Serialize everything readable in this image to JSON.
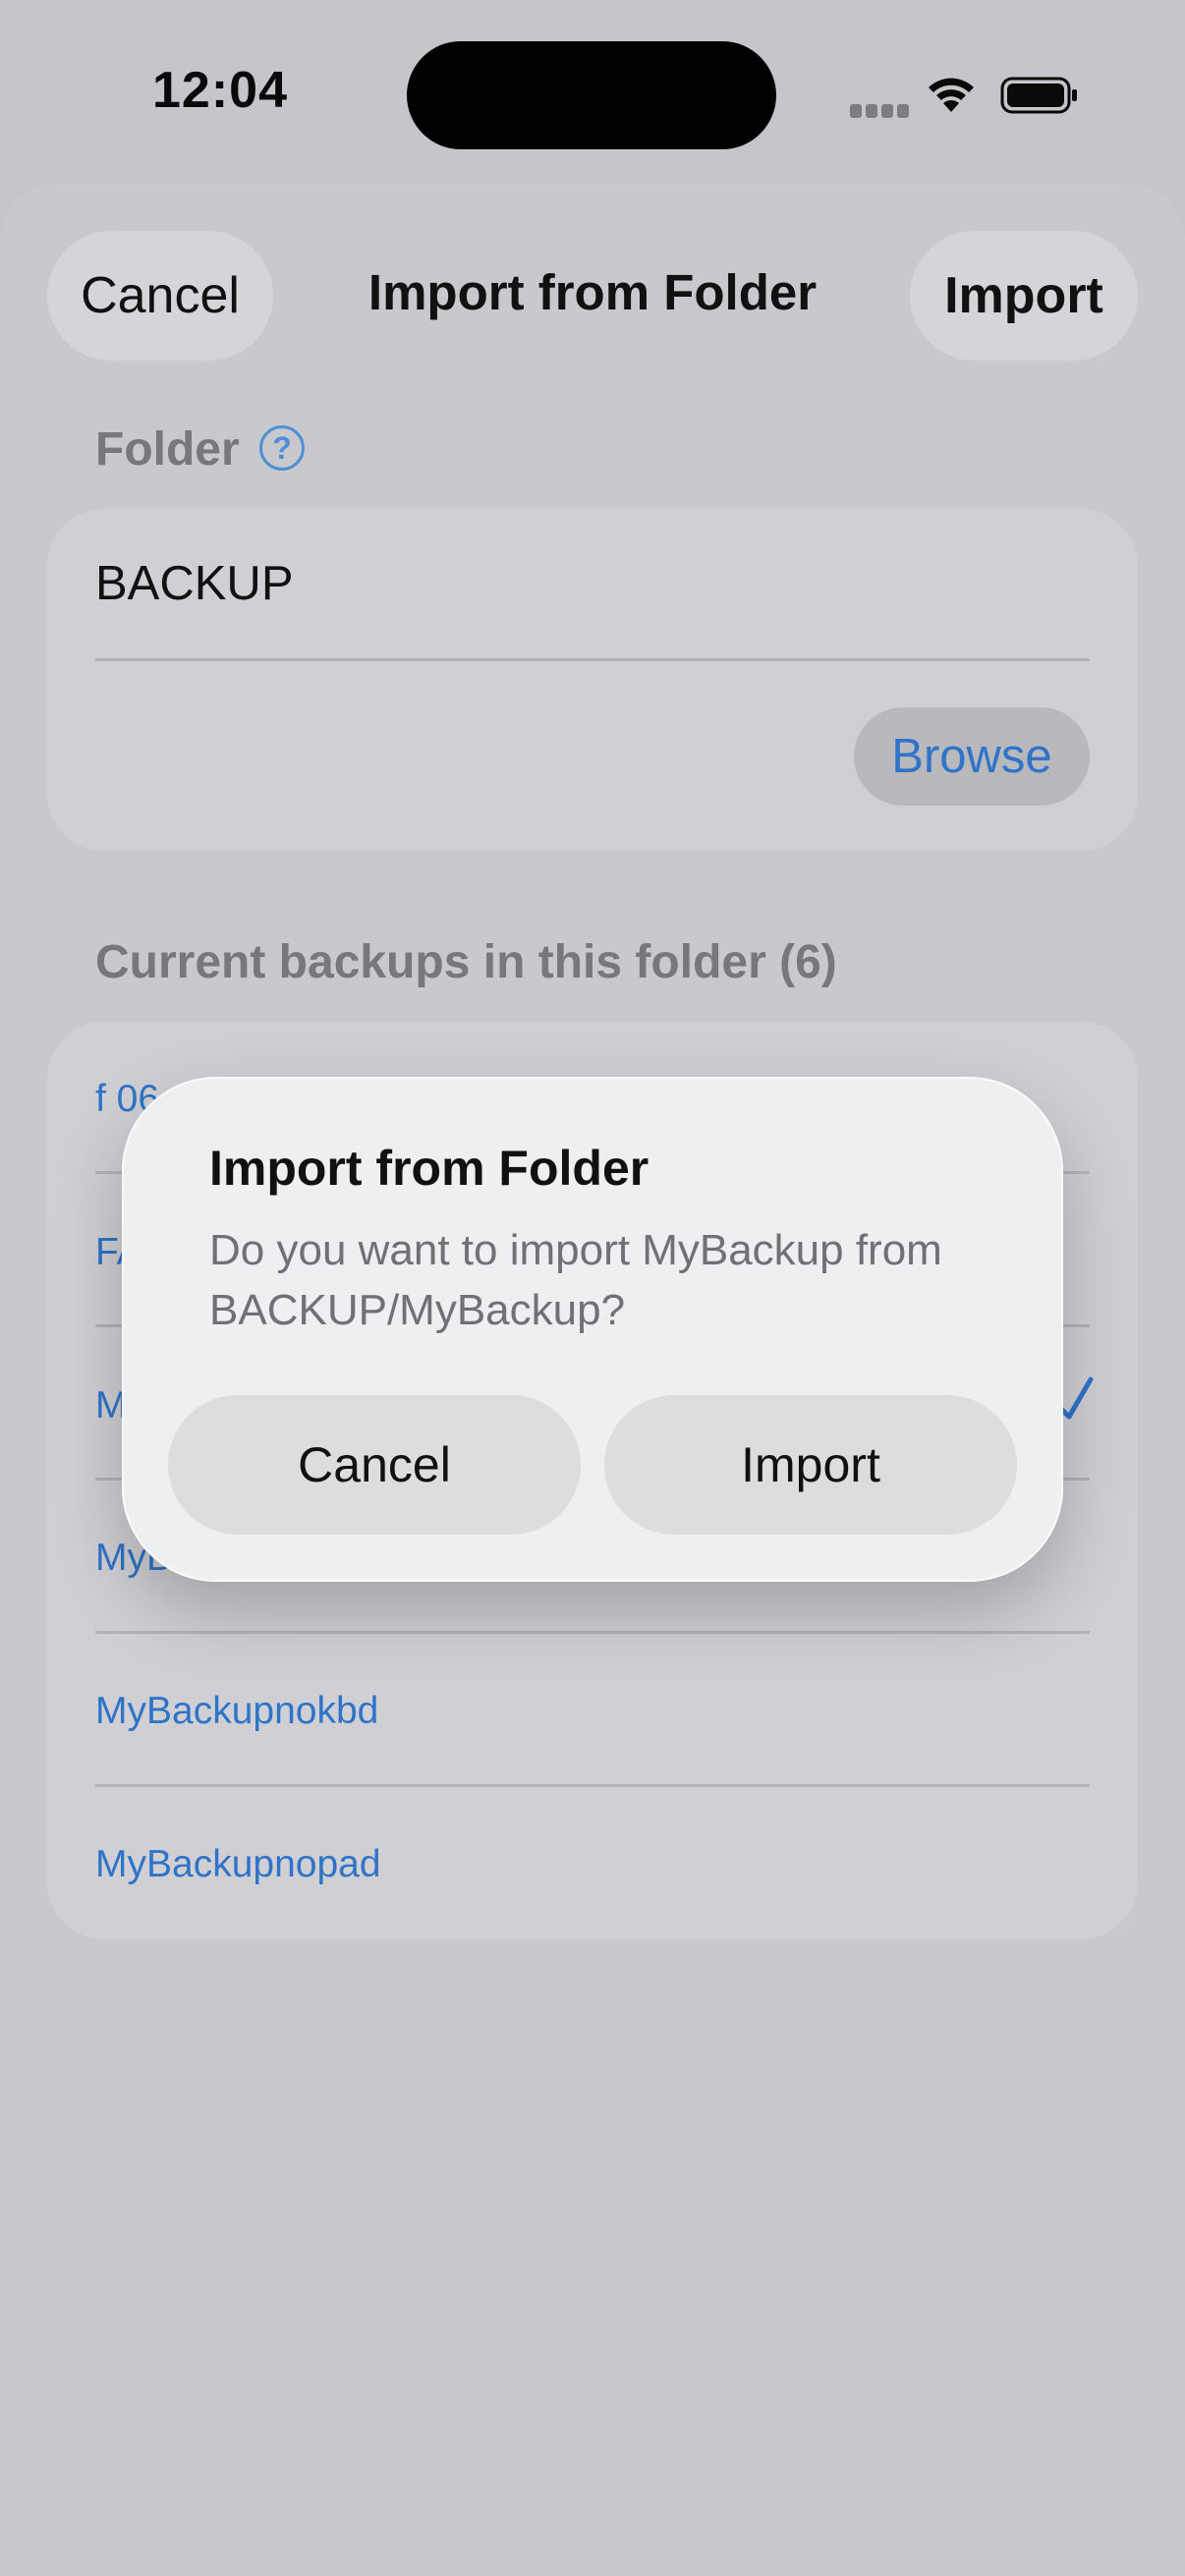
{
  "status_bar": {
    "time": "12:04"
  },
  "sheet": {
    "cancel_label": "Cancel",
    "title": "Import from Folder",
    "import_label": "Import"
  },
  "folder_section": {
    "label": "Folder",
    "help_glyph": "?",
    "value": "BACKUP",
    "browse_label": "Browse"
  },
  "backups_section": {
    "label": "Current backups in this folder (6)",
    "items": [
      {
        "label": "f 06",
        "selected": false
      },
      {
        "label": "FA",
        "selected": false
      },
      {
        "label": "M",
        "selected": true
      },
      {
        "label": "MyB",
        "selected": false
      },
      {
        "label": "MyBackupnokbd",
        "selected": false
      },
      {
        "label": "MyBackupnopad",
        "selected": false
      }
    ]
  },
  "dialog": {
    "title": "Import from Folder",
    "message": "Do you want to import MyBackup from BACKUP/MyBackup?",
    "cancel_label": "Cancel",
    "import_label": "Import"
  },
  "icons": [
    "help-icon",
    "checkmark-icon",
    "wifi-icon",
    "battery-icon",
    "cellular-signal-icon"
  ],
  "colors": {
    "accent": "#2f74c8",
    "background": "#c5c5ca",
    "dialog": "#eeeff0"
  }
}
